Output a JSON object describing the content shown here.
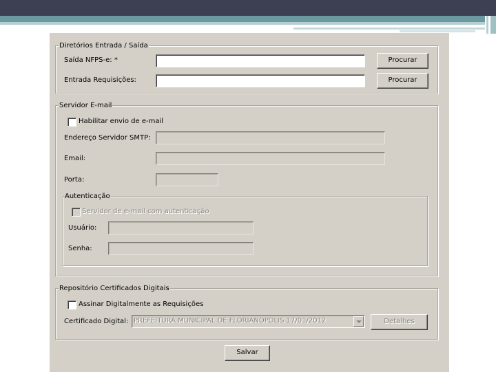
{
  "directories": {
    "legend": "Diretórios Entrada / Saída",
    "output_label": "Saída NFPS-e: *",
    "output_value": "",
    "input_label": "Entrada Requisições:",
    "input_value": "",
    "browse_label": "Procurar"
  },
  "email_server": {
    "legend": "Servidor E-mail",
    "enable_label": "Habilitar envio de e-mail",
    "enable_checked": false,
    "smtp_label": "Endereço Servidor SMTP:",
    "smtp_value": "",
    "email_label": "Email:",
    "email_value": "",
    "port_label": "Porta:",
    "port_value": "",
    "auth": {
      "legend": "Autenticação",
      "auth_checkbox_label": "Servidor de e-mail com autenticação",
      "auth_checked": false,
      "user_label": "Usuário:",
      "user_value": "",
      "password_label": "Senha:",
      "password_value": ""
    }
  },
  "certificates": {
    "legend": "Repositório Certificados Digitais",
    "sign_label": "Assinar Digitalmente as Requisições",
    "sign_checked": false,
    "cert_label": "Certificado Digital:",
    "cert_selected": "PREFEITURA MUNICIPAL DE FLORIANOPOLIS  17/01/2012",
    "details_label": "Detalhes"
  },
  "save_label": "Salvar",
  "colors": {
    "dialog_bg": "#d4d0c8",
    "header_dark": "#3d3f52",
    "header_teal": "#6a9aa0",
    "disabled_text": "#8a877f"
  }
}
